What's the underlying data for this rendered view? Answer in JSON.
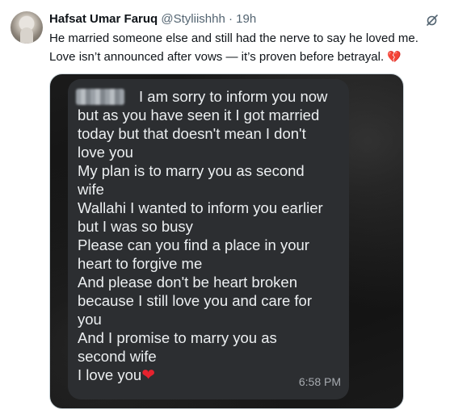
{
  "tweet": {
    "author_name": "Hafsat Umar Faruq",
    "handle": "@Styliishhh",
    "separator": " · ",
    "time": "19h",
    "text_line1": "He married someone else and still had the nerve to say he loved me.",
    "text_line2": "Love isn’t announced after vows — it’s proven before betrayal.",
    "broken_heart_emoji": "💔"
  },
  "message": {
    "lines": [
      "I am sorry to inform you now",
      "but as you have seen it I got married",
      "today but that doesn't mean I don't",
      "love you",
      "My plan is to marry you as second",
      "wife",
      "Wallahi I wanted to inform you earlier",
      "but I was so busy",
      "Please can you find a place in your",
      "heart to forgive me",
      "And please don't be heart broken",
      "because I still love you and care for",
      "you",
      "And I promise to marry you as",
      "second wife",
      "I love you"
    ],
    "heart_emoji": "❤",
    "timestamp": "6:58 PM"
  },
  "colors": {
    "text": "#0f1419",
    "muted": "#536471",
    "bubble": "#2c2e31",
    "bubble_text": "#eceff1",
    "heart": "#e5222e"
  },
  "icons": {
    "grok": "grok-icon",
    "avatar": "avatar"
  }
}
